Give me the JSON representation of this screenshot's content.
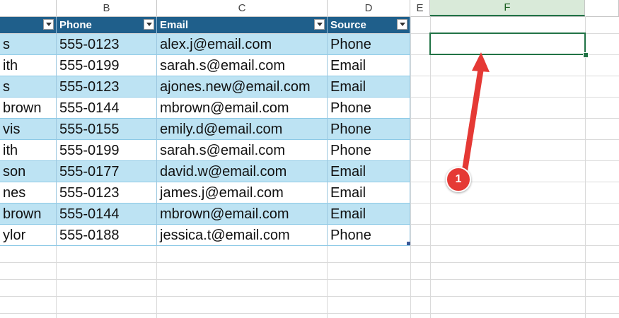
{
  "columns": [
    "B",
    "C",
    "D",
    "E",
    "F"
  ],
  "headers": {
    "phone": "Phone",
    "email": "Email",
    "source": "Source"
  },
  "rows": [
    {
      "name": "s",
      "phone": "555-0123",
      "email": "alex.j@email.com",
      "source": "Phone"
    },
    {
      "name": "ith",
      "phone": "555-0199",
      "email": "sarah.s@email.com",
      "source": "Email"
    },
    {
      "name": "s",
      "phone": "555-0123",
      "email": "ajones.new@email.com",
      "source": "Email"
    },
    {
      "name": "brown",
      "phone": "555-0144",
      "email": "mbrown@email.com",
      "source": "Phone"
    },
    {
      "name": "vis",
      "phone": "555-0155",
      "email": "emily.d@email.com",
      "source": "Phone"
    },
    {
      "name": "ith",
      "phone": "555-0199",
      "email": "sarah.s@email.com",
      "source": "Phone"
    },
    {
      "name": "son",
      "phone": "555-0177",
      "email": "david.w@email.com",
      "source": "Email"
    },
    {
      "name": "nes",
      "phone": "555-0123",
      "email": "james.j@email.com",
      "source": "Email"
    },
    {
      "name": "brown",
      "phone": "555-0144",
      "email": "mbrown@email.com",
      "source": "Email"
    },
    {
      "name": "ylor",
      "phone": "555-0188",
      "email": "jessica.t@email.com",
      "source": "Phone"
    }
  ],
  "annotation": {
    "step": "1"
  },
  "colors": {
    "header": "#1f5f8b",
    "band": "#bde3f3",
    "selection": "#217346",
    "arrow": "#e53935"
  }
}
